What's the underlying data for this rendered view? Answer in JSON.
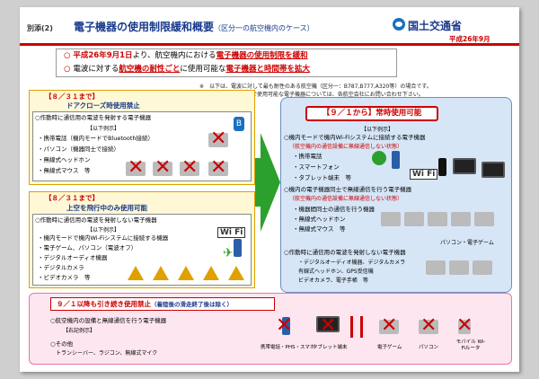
{
  "header": {
    "tag": "別添(2)",
    "title": "電子機器の使用制限緩和概要",
    "title_sub": "（区分一の航空機内のケース）",
    "ministry": "国土交通省",
    "date": "平成26年9月"
  },
  "bullets": {
    "line1_pre": "平成26年9月1日",
    "line1_mid": "より、航空機内における",
    "line1_u": "電子機器の使用制限を緩和",
    "line2_pre": "電波に対する",
    "line2_u1": "航空機の耐性ごと",
    "line2_mid": "に使用可能な",
    "line2_u2": "電子機器と時間帯を拡大"
  },
  "note": {
    "line1": "※　以下は、電波に対して最も耐性のある航空機（区分一：B787,B777,A320等）の場合です。",
    "line2": "ご搭乗の航空機内で使用可能な電子機器については、各航空会社にお問い合わせ下さい。"
  },
  "box1": {
    "date": "【８／３１まで】",
    "title": "ドアクローズ時使用禁止",
    "item_head": "○作動時に通信用の電波を発射する電子機器",
    "examples": "【以下例示】",
    "items": [
      "・携帯電話（機内モードでBluetooth接続）",
      "・パソコン（機器同士で接続）",
      "・無線式ヘッドホン",
      "・無線式マウス　等"
    ]
  },
  "box2": {
    "date": "【８／３１まで】",
    "title": "上空を飛行中のみ使用可能",
    "item_head": "○作動時に通信用の電波を発射しない電子機器",
    "examples": "【以下例示】",
    "items": [
      "・機内モードで機内Wi-Fiシステムに接続する機器",
      "・電子ゲーム、パソコン（電波オフ）",
      "・デジタルオーディオ機器",
      "・デジタルカメラ",
      "・ビデオカメラ　等"
    ]
  },
  "right": {
    "title_pre": "【９／１から】",
    "title_main": "常時使用可能",
    "examples": "【以下例示】",
    "g1_head": "○機内モードで機内Wi-Fiシステムに接続する電子機器",
    "g1_note": "（航空機内の通信設備に無線通信しない状態）",
    "g1_items": [
      "・携帯電話",
      "・スマートフォン",
      "・タブレット端末　等"
    ],
    "g2_head": "○機内の電子機器同士で無線通信を行う電子機器",
    "g2_note": "（航空機内の通信設備に無線通信しない状態）",
    "g2_items": [
      "・機器間同士の通信を行う機器",
      "・無線式ヘッドホン",
      "・無線式マウス　等"
    ],
    "g2_caption": "パソコン・電子ゲーム",
    "g3_head": "○作動時に通信用の電波を発射しない電子機器",
    "g3_items": [
      "・デジタルオーディオ機器、デジタルカメラ",
      "有線式ヘッドホン、GPS受信機",
      "ビデオカメラ、電子手帳　等"
    ],
    "wifi_label": "Wi Fi"
  },
  "bottom": {
    "title": "９／１以降も引き続き使用禁止",
    "title_note": "（着陸後の滑走終了後は除く）",
    "item1": "○航空機内の設備と無線通信を行う電子機器",
    "examples": "【右記例示】",
    "item2": "○その他",
    "item2_sub": "トランシーバー、ラジコン、無線式マイク",
    "captions": [
      "携帯電話・PHS・スマホ",
      "タブレット端末",
      "電子ゲーム",
      "パソコン",
      "モバイル Wi-Fiルータ"
    ]
  },
  "colors": {
    "red": "#cc0000",
    "blue": "#1a3a8c",
    "green": "#2ca02c"
  }
}
